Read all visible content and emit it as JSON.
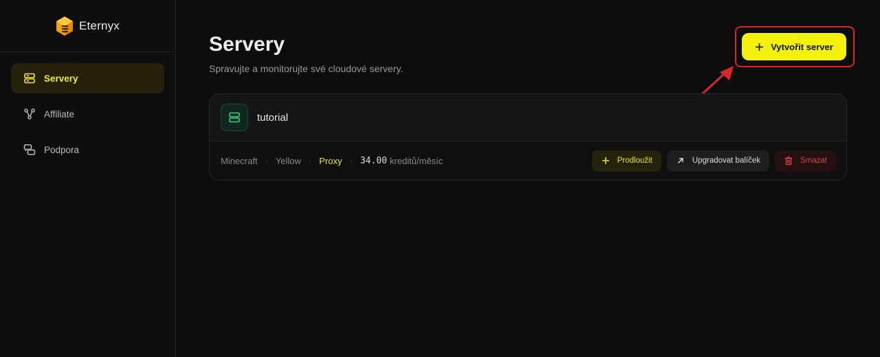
{
  "brand": {
    "name": "Eternyx"
  },
  "sidebar": {
    "items": [
      {
        "label": "Servery",
        "icon": "server-icon",
        "active": true
      },
      {
        "label": "Affiliate",
        "icon": "share-icon",
        "active": false
      },
      {
        "label": "Podpora",
        "icon": "chat-icon",
        "active": false
      }
    ]
  },
  "header": {
    "title": "Servery",
    "subtitle": "Spravujte a monitorujte své cloudové servery.",
    "create_label": "Vytvořit server"
  },
  "annotation": {
    "step": "1",
    "color": "#d8262c"
  },
  "server": {
    "name": "tutorial",
    "game": "Minecraft",
    "plan": "Yellow",
    "type": "Proxy",
    "credits": "34.00",
    "credits_unit": "kreditů/měsíc",
    "actions": {
      "extend": "Prodloužit",
      "upgrade": "Upgradovat balíček",
      "delete": "Smazat"
    }
  },
  "colors": {
    "accent": "#f4f10c",
    "danger": "#d64545",
    "server_icon": "#2bd48a"
  }
}
